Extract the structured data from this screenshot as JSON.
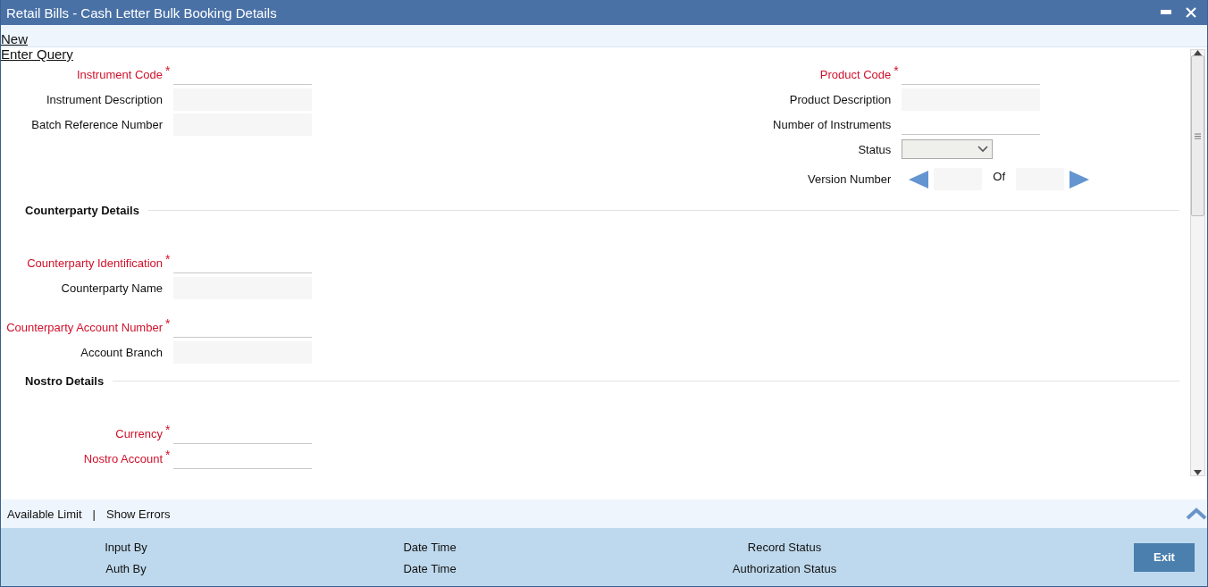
{
  "window": {
    "title": "Retail Bills - Cash Letter Bulk Booking Details"
  },
  "toolbar": [
    {
      "label": "New"
    },
    {
      "label": "Enter Query"
    }
  ],
  "header_left": [
    {
      "label": "Instrument Code",
      "required": true,
      "mark": "*",
      "kind": "line"
    },
    {
      "label": "Instrument Description",
      "required": false,
      "kind": "filled"
    },
    {
      "label": "Batch Reference Number",
      "required": false,
      "kind": "filled"
    }
  ],
  "header_right": [
    {
      "label": "Product Code",
      "required": true,
      "mark": "*",
      "kind": "line"
    },
    {
      "label": "Product Description",
      "required": false,
      "kind": "filled"
    },
    {
      "label": "Number of Instruments",
      "required": false,
      "kind": "line"
    },
    {
      "label": "Status",
      "required": false,
      "kind": "select"
    },
    {
      "label": "Version Number",
      "required": false,
      "kind": "version",
      "of_label": "Of"
    }
  ],
  "sections": [
    {
      "title": "Counterparty Details",
      "groups": [
        [
          {
            "label": "Counterparty Identification",
            "required": true,
            "mark": "*",
            "kind": "line"
          },
          {
            "label": "Counterparty Name",
            "required": false,
            "kind": "filled"
          }
        ],
        [
          {
            "label": "Counterparty Account Number",
            "required": true,
            "mark": "*",
            "kind": "line"
          },
          {
            "label": "Account Branch",
            "required": false,
            "kind": "filled"
          }
        ]
      ]
    },
    {
      "title": "Nostro Details",
      "groups": [
        [
          {
            "label": "Currency",
            "required": true,
            "mark": "*",
            "kind": "line"
          },
          {
            "label": "Nostro Account",
            "required": true,
            "mark": "*",
            "kind": "line"
          }
        ]
      ]
    }
  ],
  "footer_links": [
    {
      "label": "Available Limit"
    },
    {
      "label": "Show Errors"
    }
  ],
  "footer_separator": "|",
  "audit": [
    {
      "label": "Input By"
    },
    {
      "label": "Date Time"
    },
    {
      "label": "Record Status"
    },
    {
      "label": "Auth By"
    },
    {
      "label": "Date Time"
    },
    {
      "label": "Authorization Status"
    }
  ],
  "buttons": [
    {
      "label": "Exit"
    }
  ]
}
